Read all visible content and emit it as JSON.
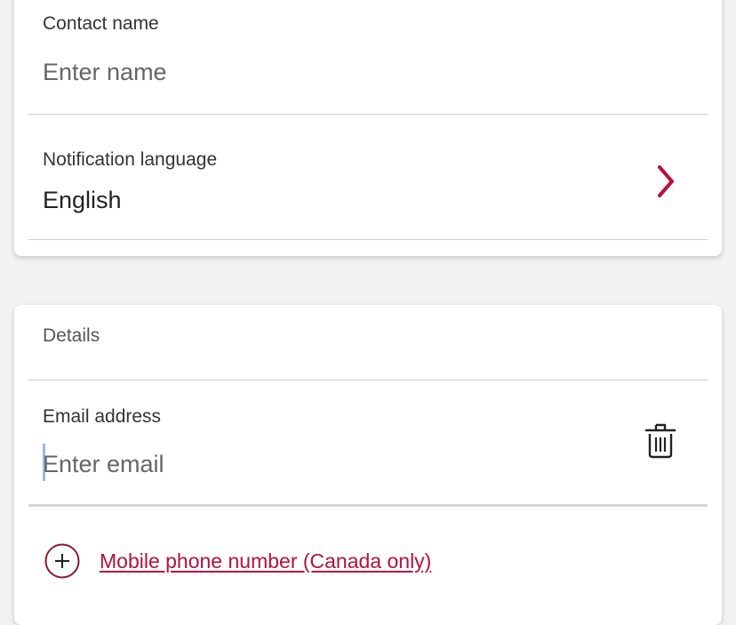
{
  "contact": {
    "name_label": "Contact name",
    "name_placeholder": "Enter name",
    "language_label": "Notification language",
    "language_value": "English"
  },
  "details": {
    "section_title": "Details",
    "email_label": "Email address",
    "email_placeholder": "Enter email",
    "add_phone_label": "Mobile phone number (Canada only)"
  },
  "icons": {
    "language": "chevron-right-icon",
    "delete": "trash-icon",
    "add": "plus-circle-icon"
  },
  "colors": {
    "accent": "#b3123c",
    "background": "#f2f2f2",
    "card": "#ffffff"
  }
}
